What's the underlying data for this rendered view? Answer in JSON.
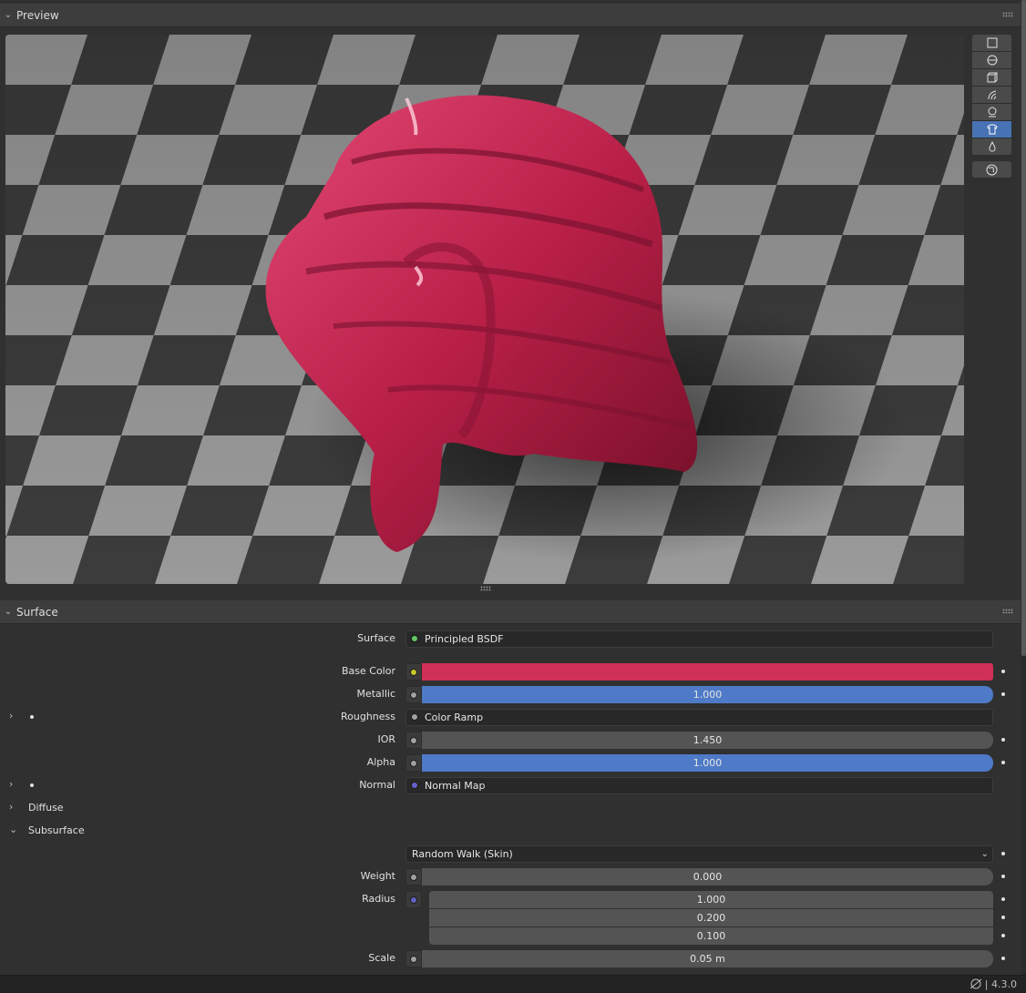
{
  "preview": {
    "title": "Preview",
    "tools": [
      {
        "name": "flat-icon"
      },
      {
        "name": "sphere-icon"
      },
      {
        "name": "cube-icon"
      },
      {
        "name": "hair-icon"
      },
      {
        "name": "monkey-icon"
      },
      {
        "name": "cloth-icon",
        "active": true
      },
      {
        "name": "fluid-icon"
      }
    ],
    "world_tool": {
      "name": "world-lighting-icon"
    }
  },
  "surface_panel": {
    "title": "Surface",
    "surface": {
      "label": "Surface",
      "value": "Principled BSDF",
      "socket_color": "#63c763"
    },
    "base_color": {
      "label": "Base Color",
      "color": "#cf3056",
      "socket_color": "#c7c729"
    },
    "metallic": {
      "label": "Metallic",
      "value": "1.000"
    },
    "roughness": {
      "label": "Roughness",
      "value": "Color Ramp"
    },
    "ior": {
      "label": "IOR",
      "value": "1.450"
    },
    "alpha": {
      "label": "Alpha",
      "value": "1.000"
    },
    "normal": {
      "label": "Normal",
      "value": "Normal Map",
      "socket_color": "#6363c7"
    },
    "diffuse": {
      "title": "Diffuse"
    },
    "subsurface": {
      "title": "Subsurface",
      "method": "Random Walk (Skin)",
      "weight": {
        "label": "Weight",
        "value": "0.000"
      },
      "radius": {
        "label": "Radius",
        "values": [
          "1.000",
          "0.200",
          "0.100"
        ]
      },
      "scale": {
        "label": "Scale",
        "value": "0.05 m"
      }
    }
  },
  "status": {
    "version": "4.3.0"
  },
  "colors": {
    "accent": "#4772b3",
    "slider_blue": "#4e7ac7",
    "material": "#cf3056"
  }
}
